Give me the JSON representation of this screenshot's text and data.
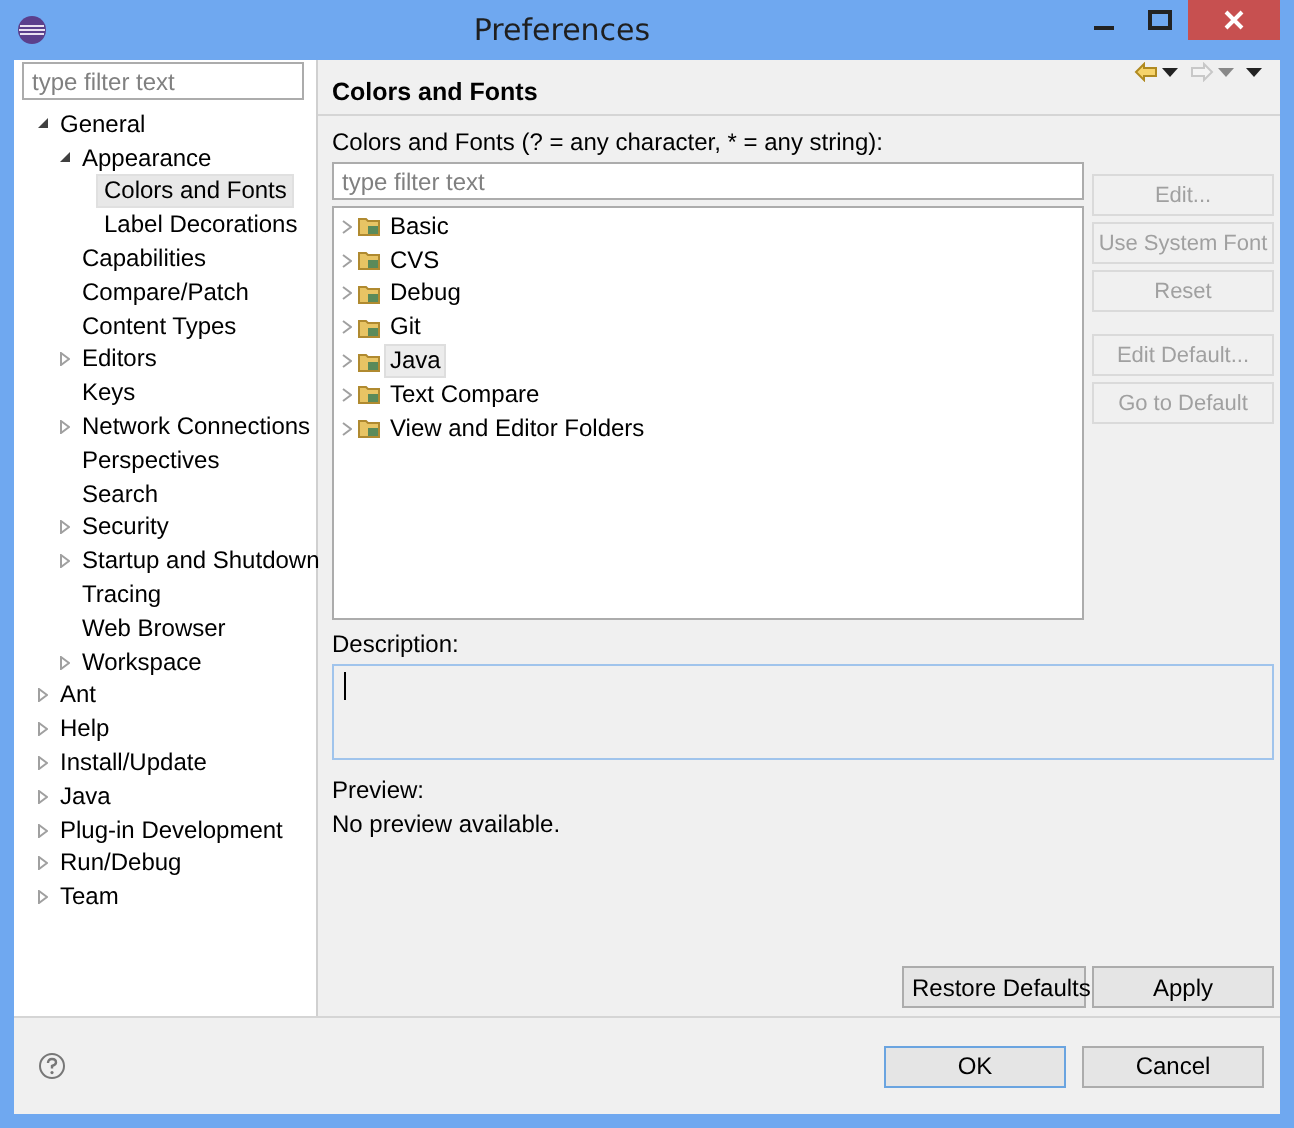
{
  "window": {
    "title": "Preferences"
  },
  "sidebar": {
    "filter": {
      "placeholder": "type filter text"
    },
    "items": [
      {
        "label": "General",
        "expanded": true,
        "selected": false,
        "children": [
          {
            "label": "Appearance",
            "expanded": true,
            "selected": false,
            "children": [
              {
                "label": "Colors and Fonts",
                "selected": true
              },
              {
                "label": "Label Decorations",
                "selected": false
              }
            ]
          },
          {
            "label": "Capabilities",
            "selected": false
          },
          {
            "label": "Compare/Patch",
            "selected": false
          },
          {
            "label": "Content Types",
            "selected": false
          },
          {
            "label": "Editors",
            "expanded": false,
            "selected": false
          },
          {
            "label": "Keys",
            "selected": false
          },
          {
            "label": "Network Connections",
            "expanded": false,
            "selected": false
          },
          {
            "label": "Perspectives",
            "selected": false
          },
          {
            "label": "Search",
            "selected": false
          },
          {
            "label": "Security",
            "expanded": false,
            "selected": false
          },
          {
            "label": "Startup and Shutdown",
            "expanded": false,
            "selected": false
          },
          {
            "label": "Tracing",
            "selected": false
          },
          {
            "label": "Web Browser",
            "selected": false
          },
          {
            "label": "Workspace",
            "expanded": false,
            "selected": false
          }
        ]
      },
      {
        "label": "Ant",
        "expanded": false,
        "selected": false
      },
      {
        "label": "Help",
        "expanded": false,
        "selected": false
      },
      {
        "label": "Install/Update",
        "expanded": false,
        "selected": false
      },
      {
        "label": "Java",
        "expanded": false,
        "selected": false
      },
      {
        "label": "Plug-in Development",
        "expanded": false,
        "selected": false
      },
      {
        "label": "Run/Debug",
        "expanded": false,
        "selected": false
      },
      {
        "label": "Team",
        "expanded": false,
        "selected": false
      }
    ]
  },
  "page": {
    "title": "Colors and Fonts",
    "filter_label": "Colors and Fonts (? = any character, * = any string):",
    "filter": {
      "placeholder": "type filter text"
    },
    "categories": [
      {
        "label": "Basic",
        "selected": false
      },
      {
        "label": "CVS",
        "selected": false
      },
      {
        "label": "Debug",
        "selected": false
      },
      {
        "label": "Git",
        "selected": false
      },
      {
        "label": "Java",
        "selected": true
      },
      {
        "label": "Text Compare",
        "selected": false
      },
      {
        "label": "View and Editor Folders",
        "selected": false
      }
    ],
    "side_button_groups": [
      [
        {
          "label": "Edit...",
          "disabled": true
        },
        {
          "label": "Use System Font",
          "disabled": true
        },
        {
          "label": "Reset",
          "disabled": true
        }
      ],
      [
        {
          "label": "Edit Default...",
          "disabled": true
        },
        {
          "label": "Go to Default",
          "disabled": true
        }
      ]
    ],
    "description_label": "Description:",
    "preview_label": "Preview:",
    "preview_text": "No preview available.",
    "buttons": [
      "Restore Defaults",
      "Apply"
    ]
  },
  "footer": {
    "buttons": [
      {
        "label": "OK",
        "default": true
      },
      {
        "label": "Cancel",
        "default": false
      }
    ]
  }
}
